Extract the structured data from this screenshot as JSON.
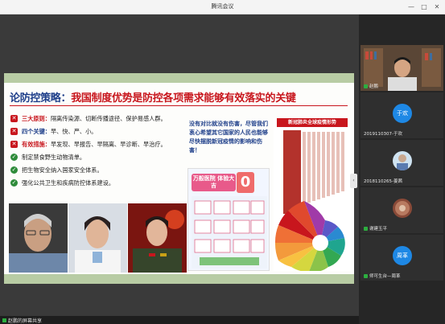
{
  "window": {
    "title": "腾讯会议",
    "controls": [
      "—",
      "□",
      "✕"
    ]
  },
  "slide": {
    "title_part1": "论防控策略：",
    "title_part2": "我国制度优势是防控各项需求能够有效落实的关键",
    "bullets": [
      {
        "icon": "✕",
        "label": "三大原则：",
        "text": "隔离传染源、切断传播途径、保护易感人群。"
      },
      {
        "icon": "✕",
        "label": "四个关键：",
        "text": "早、快、严、小。"
      },
      {
        "icon": "✕",
        "label": "有效措施：",
        "text": "早发现、早报告、早隔离、早诊断、早治疗。"
      },
      {
        "icon": "✓",
        "label": "",
        "text": "制定禁食野生动物清单。"
      },
      {
        "icon": "✓",
        "label": "",
        "text": "把生物安全纳入国家安全体系。"
      },
      {
        "icon": "✓",
        "label": "",
        "text": "强化公共卫生和疾病防控体系建设。"
      }
    ],
    "quote": "没有对比就没有伤害，尽管我们衷心希望其它国家的人民也能够尽快摆脱新冠疫情的影响和伤害！",
    "poster_banner": "万般医院 体验大吉",
    "poster_number": "0",
    "chart_title": "新冠肺炎全球疫情形势"
  },
  "participants": [
    {
      "name": "赵鹏",
      "type": "video"
    },
    {
      "name": "2019110307-于欢",
      "avatar_text": "于欢",
      "type": "avatar"
    },
    {
      "name": "2018110265-姜茜",
      "type": "avatar-photo"
    },
    {
      "name": "谢建玉平",
      "type": "avatar-photo"
    },
    {
      "name": "师可生台—周革",
      "avatar_text": "周革",
      "type": "avatar"
    }
  ],
  "share_status": "赵鹏的屏幕共享",
  "colors": {
    "accent_red": "#c8161d",
    "title_blue": "#1f3f8a",
    "slide_band": "#b8cca4",
    "avatar_blue": "#1e88e5",
    "mic_green": "#2cae3f"
  }
}
